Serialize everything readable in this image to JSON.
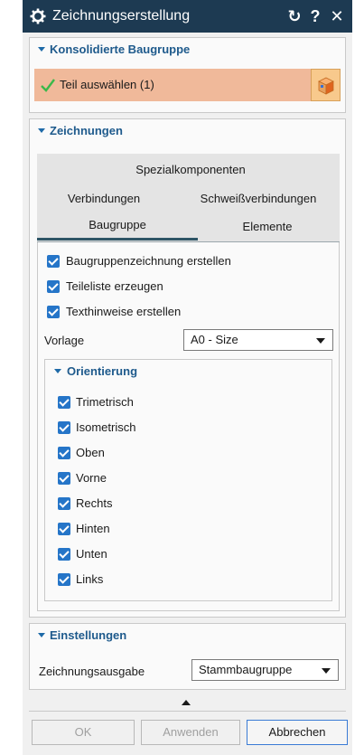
{
  "window": {
    "title": "Zeichnungserstellung",
    "reset_glyph": "↻",
    "help_glyph": "?",
    "close_glyph": "✕"
  },
  "consolidated": {
    "title": "Konsolidierte Baugruppe",
    "select_label": "Teil auswählen (1)"
  },
  "drawings": {
    "title": "Zeichnungen",
    "tabs": {
      "special": "Spezialkomponenten",
      "connections": "Verbindungen",
      "welds": "Schweißverbindungen",
      "assembly": "Baugruppe",
      "elements": "Elemente"
    },
    "active_tab": "Baugruppe",
    "options": [
      {
        "label": "Baugruppenzeichnung erstellen",
        "checked": true
      },
      {
        "label": "Teileliste erzeugen",
        "checked": true
      },
      {
        "label": "Texthinweise erstellen",
        "checked": true
      }
    ],
    "template": {
      "label": "Vorlage",
      "value": "A0 - Size"
    },
    "orientation": {
      "title": "Orientierung",
      "items": [
        {
          "label": "Trimetrisch",
          "checked": true
        },
        {
          "label": "Isometrisch",
          "checked": true
        },
        {
          "label": "Oben",
          "checked": true
        },
        {
          "label": "Vorne",
          "checked": true
        },
        {
          "label": "Rechts",
          "checked": true
        },
        {
          "label": "Hinten",
          "checked": true
        },
        {
          "label": "Unten",
          "checked": true
        },
        {
          "label": "Links",
          "checked": true
        }
      ]
    }
  },
  "settings": {
    "title": "Einstellungen",
    "output_label": "Zeichnungsausgabe",
    "output_value": "Stammbaugruppe"
  },
  "buttons": {
    "ok": "OK",
    "apply": "Anwenden",
    "cancel": "Abbrechen"
  },
  "colors": {
    "titlebar": "#1d3a52",
    "section_title": "#1e5a8c",
    "checkbox": "#2575c8",
    "selection_row": "#f0b99a"
  }
}
